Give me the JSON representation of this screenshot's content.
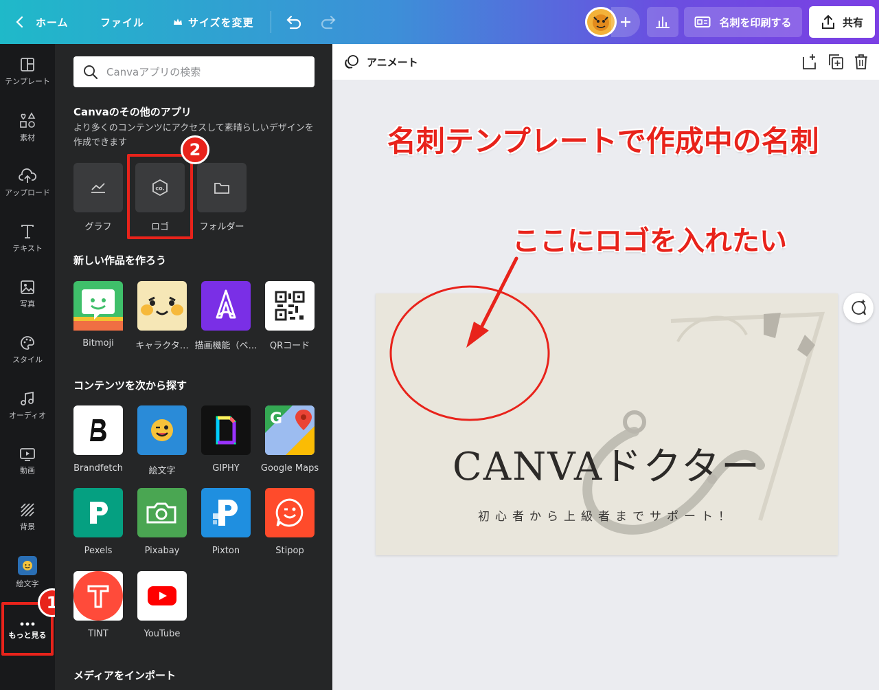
{
  "topbar": {
    "home_label": "ホーム",
    "file_label": "ファイル",
    "resize_label": "サイズを変更",
    "print_label": "名刺を印刷する",
    "share_label": "共有"
  },
  "rail": {
    "items": [
      {
        "label": "テンプレート",
        "icon": "template-icon"
      },
      {
        "label": "素材",
        "icon": "elements-icon"
      },
      {
        "label": "アップロード",
        "icon": "upload-cloud-icon"
      },
      {
        "label": "テキスト",
        "icon": "text-icon"
      },
      {
        "label": "写真",
        "icon": "photo-icon"
      },
      {
        "label": "スタイル",
        "icon": "palette-icon"
      },
      {
        "label": "オーディオ",
        "icon": "music-note-icon"
      },
      {
        "label": "動画",
        "icon": "video-icon"
      },
      {
        "label": "背景",
        "icon": "background-pattern-icon"
      },
      {
        "label": "絵文字",
        "icon": "emoji-icon"
      },
      {
        "label": "もっと見る",
        "icon": "more-dots-icon"
      }
    ]
  },
  "panel": {
    "search_placeholder": "Canvaアプリの検索",
    "other_apps_title": "Canvaのその他のアプリ",
    "other_apps_desc": "より多くのコンテンツにアクセスして素晴らしいデザインを作成できます",
    "tools": [
      {
        "label": "グラフ",
        "icon": "chart-line-icon"
      },
      {
        "label": "ロゴ",
        "icon": "logo-hexagon-icon"
      },
      {
        "label": "フォルダー",
        "icon": "folder-icon"
      }
    ],
    "create_title": "新しい作品を作ろう",
    "create_apps": [
      {
        "label": "Bitmoji",
        "icon": "bitmoji-icon",
        "color": "#3fbf6a"
      },
      {
        "label": "キャラクタ…",
        "icon": "character-face-icon",
        "color": "#f6e7b6"
      },
      {
        "label": "描画機能（ベ…",
        "icon": "draw-pen-icon",
        "color": "#7a2fe6"
      },
      {
        "label": "QRコード",
        "icon": "qr-code-icon",
        "color": "#ffffff"
      }
    ],
    "explore_title": "コンテンツを次から探す",
    "explore_apps": [
      {
        "label": "Brandfetch",
        "icon": "brandfetch-icon",
        "color": "#ffffff"
      },
      {
        "label": "絵文字",
        "icon": "emoji-wink-icon",
        "color": "#2a8bd8"
      },
      {
        "label": "GIPHY",
        "icon": "giphy-icon",
        "color": "#111111"
      },
      {
        "label": "Google Maps",
        "icon": "google-maps-icon",
        "color": "#ffffff"
      },
      {
        "label": "Pexels",
        "icon": "pexels-icon",
        "color": "#05a081"
      },
      {
        "label": "Pixabay",
        "icon": "pixabay-camera-icon",
        "color": "#4aa652"
      },
      {
        "label": "Pixton",
        "icon": "pixton-icon",
        "color": "#1f8fe0"
      },
      {
        "label": "Stipop",
        "icon": "stipop-icon",
        "color": "#ff4b2b"
      },
      {
        "label": "TINT",
        "icon": "tint-icon",
        "color": "#ff4b3a"
      },
      {
        "label": "YouTube",
        "icon": "youtube-play-icon",
        "color": "#ffffff"
      }
    ],
    "import_title": "メディアをインポート"
  },
  "editor": {
    "animate_label": "アニメート"
  },
  "annotations": {
    "headline": "名刺テンプレートで作成中の名刺",
    "logo_note": "ここにロゴを入れたい",
    "badge_1": "1",
    "badge_2": "2",
    "color": "#e8231b"
  },
  "card": {
    "title": "CANVAドクター",
    "subtitle": "初心者から上級者までサポート！",
    "background": "#e9e6dc"
  }
}
